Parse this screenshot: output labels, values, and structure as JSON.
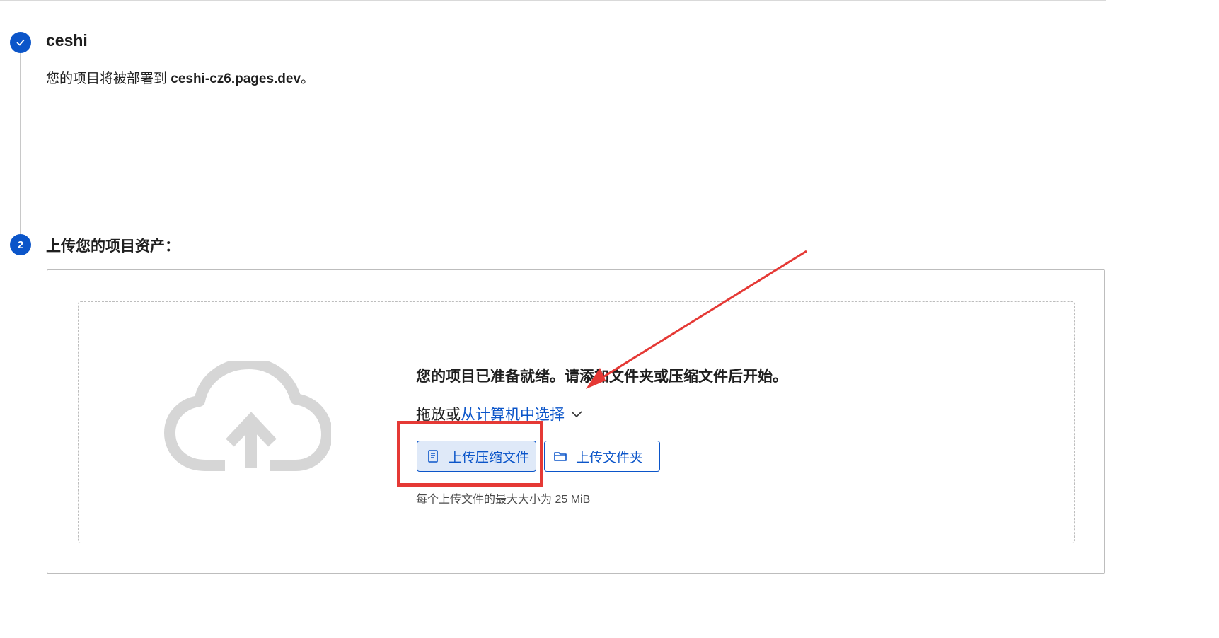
{
  "step1": {
    "icon": "check-icon",
    "title": "ceshi",
    "deploy_prefix": "您的项目将被部署到 ",
    "deploy_domain": "ceshi-cz6.pages.dev",
    "deploy_suffix": "。"
  },
  "step2": {
    "number": "2",
    "title": "上传您的项目资产："
  },
  "upload": {
    "cloud_icon": "cloud-upload-icon",
    "ready_text": "您的项目已准备就绪。请添加文件夹或压缩文件后开始。",
    "drag_prefix": "拖放或",
    "select_link": "从计算机中选择",
    "zip_button_label": "上传压缩文件",
    "zip_button_icon": "file-icon",
    "folder_button_label": "上传文件夹",
    "folder_button_icon": "folder-icon",
    "max_size_text": "每个上传文件的最大大小为 25 MiB"
  },
  "colors": {
    "accent": "#0b55c9",
    "annotation_red": "#e53935",
    "cloud_gray": "#d6d6d6",
    "zip_button_bg": "#dfe9f8"
  }
}
